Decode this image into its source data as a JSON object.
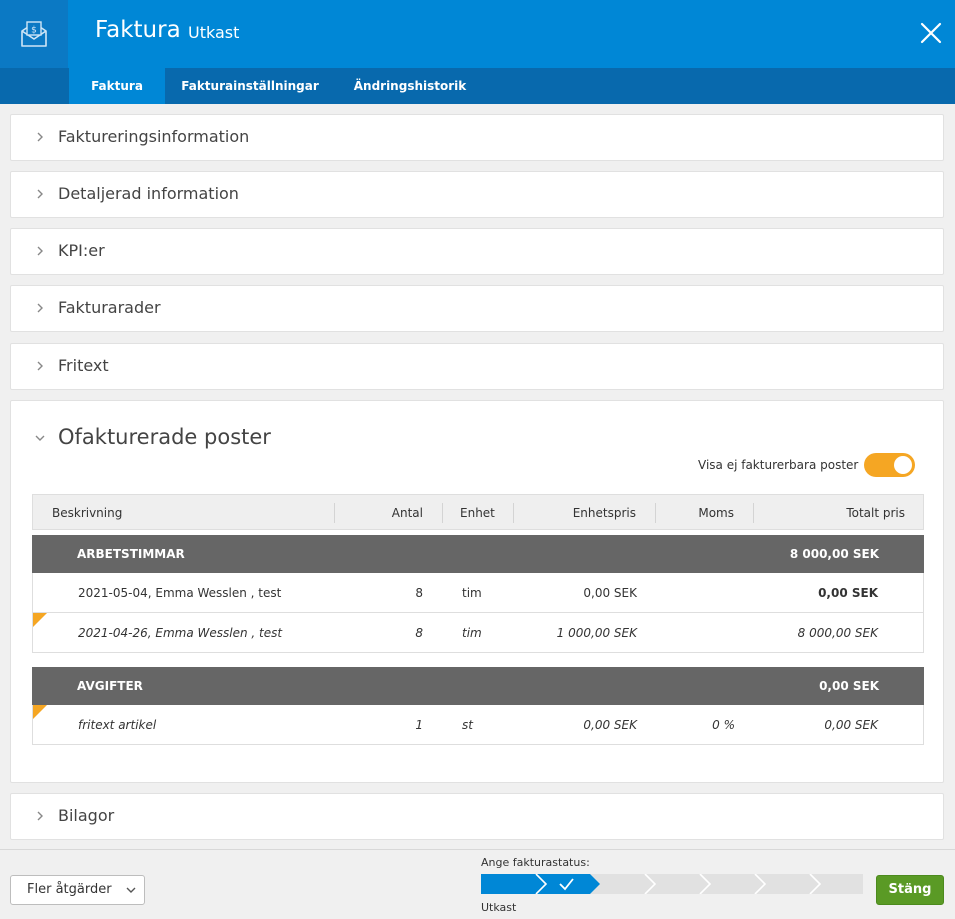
{
  "header": {
    "title": "Faktura",
    "status": "Utkast",
    "icon": "invoice-envelope-icon"
  },
  "tabs": [
    {
      "label": "Faktura",
      "active": true
    },
    {
      "label": "Fakturainställningar",
      "active": false
    },
    {
      "label": "Ändringshistorik",
      "active": false
    }
  ],
  "sections": {
    "fakturering": "Faktureringsinformation",
    "detaljerad": "Detaljerad information",
    "kpi": "KPI:er",
    "fakturarader": "Fakturarader",
    "fritext": "Fritext",
    "ofakturerade": "Ofakturerade poster",
    "bilagor": "Bilagor"
  },
  "toggle": {
    "label": "Visa ej fakturerbara poster",
    "on": true,
    "color": "#f5a623"
  },
  "table": {
    "columns": {
      "beskrivning": "Beskrivning",
      "antal": "Antal",
      "enhet": "Enhet",
      "enhetspris": "Enhetspris",
      "moms": "Moms",
      "totalt": "Totalt pris"
    },
    "groups": [
      {
        "name": "ARBETSTIMMAR",
        "total": "8 000,00 SEK",
        "rows": [
          {
            "description": "2021-05-04, Emma Wesslen , test",
            "qty": "8",
            "unit": "tim",
            "unit_price": "0,00 SEK",
            "vat": "",
            "total": "0,00 SEK"
          },
          {
            "description": "2021-04-26, Emma Wesslen , test",
            "qty": "8",
            "unit": "tim",
            "unit_price": "1 000,00 SEK",
            "vat": "",
            "total": "8 000,00 SEK"
          }
        ]
      },
      {
        "name": "AVGIFTER",
        "total": "0,00 SEK",
        "rows": [
          {
            "description": "fritext artikel",
            "qty": "1",
            "unit": "st",
            "unit_price": "0,00 SEK",
            "vat": "0 %",
            "total": "0,00 SEK"
          }
        ]
      }
    ]
  },
  "footer": {
    "more_actions": "Fler åtgärder",
    "status_label": "Ange fakturastatus:",
    "status_value": "Utkast",
    "close_button": "Stäng"
  },
  "colors": {
    "header": "#0087d6",
    "tabbar": "#0869ad",
    "group_row": "#666666",
    "status_active": "#0087d6",
    "primary_button": "#5a9a25"
  }
}
